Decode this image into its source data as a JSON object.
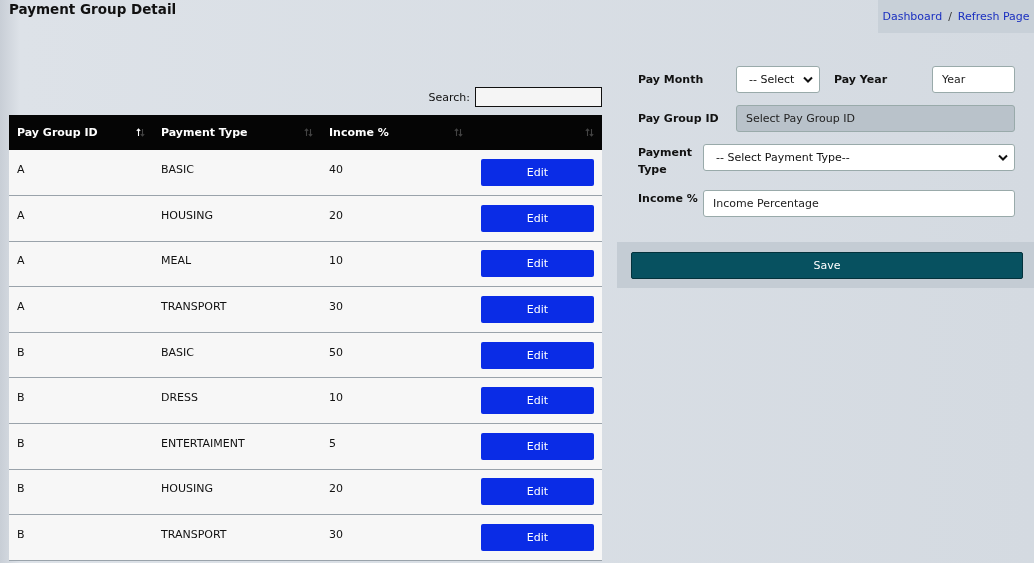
{
  "title": "Payment Group Detail",
  "breadcrumb": [
    {
      "label": "Dashboard"
    },
    {
      "label": "Refresh Page"
    }
  ],
  "breadcrumb_separator": "/",
  "search": {
    "label": "Search:"
  },
  "table": {
    "columns": [
      {
        "label": "Pay Group ID",
        "sorted": true
      },
      {
        "label": "Payment Type",
        "sorted": false
      },
      {
        "label": "Income %",
        "sorted": false
      },
      {
        "sorted": false
      }
    ],
    "rows": [
      {
        "pay_group_id": "A",
        "payment_type": "BASIC",
        "income": "40",
        "action": "Edit"
      },
      {
        "pay_group_id": "A",
        "payment_type": "HOUSING",
        "income": "20",
        "action": "Edit"
      },
      {
        "pay_group_id": "A",
        "payment_type": "MEAL",
        "income": "10",
        "action": "Edit"
      },
      {
        "pay_group_id": "A",
        "payment_type": "TRANSPORT",
        "income": "30",
        "action": "Edit"
      },
      {
        "pay_group_id": "B",
        "payment_type": "BASIC",
        "income": "50",
        "action": "Edit"
      },
      {
        "pay_group_id": "B",
        "payment_type": "DRESS",
        "income": "10",
        "action": "Edit"
      },
      {
        "pay_group_id": "B",
        "payment_type": "ENTERTAIMENT",
        "income": "5",
        "action": "Edit"
      },
      {
        "pay_group_id": "B",
        "payment_type": "HOUSING",
        "income": "20",
        "action": "Edit"
      },
      {
        "pay_group_id": "B",
        "payment_type": "TRANSPORT",
        "income": "30",
        "action": "Edit"
      }
    ]
  },
  "form": {
    "pay_month": {
      "label": "Pay Month",
      "value": "-- Select"
    },
    "pay_year": {
      "label": "Pay Year",
      "placeholder": "Year"
    },
    "pay_group_id": {
      "label": "Pay Group ID",
      "placeholder": "Select Pay Group ID",
      "disabled": true
    },
    "payment_type": {
      "label": "Payment Type",
      "value": "-- Select Payment Type--"
    },
    "income": {
      "label": "Income %",
      "placeholder": "Income Percentage"
    },
    "save": "Save"
  }
}
